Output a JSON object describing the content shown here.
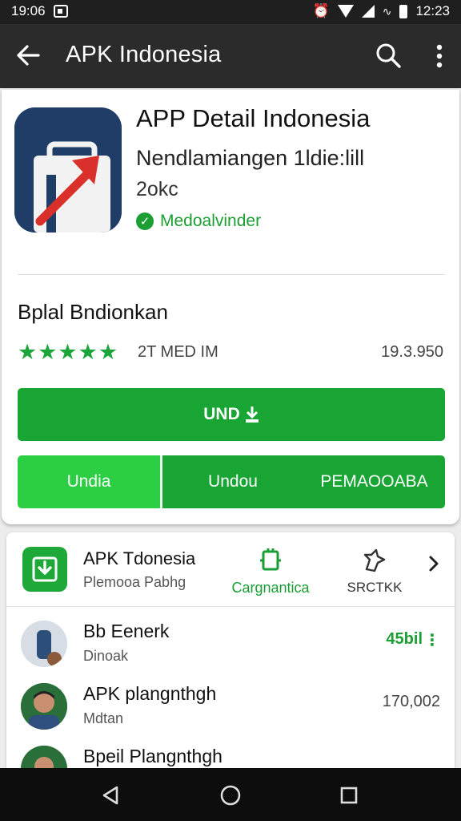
{
  "status_bar": {
    "time_left": "19:06",
    "time_right": "12:23"
  },
  "app_bar": {
    "title": "APK Indonesia"
  },
  "app": {
    "title": "APP  Detail Indonesia",
    "developer": "Nendlamiangen 1ldie:lill",
    "size": "2okc",
    "verified_label": "Medoalvinder"
  },
  "section": {
    "title": "Bplal Bndionkan",
    "stars": "★★★★★",
    "stat_mid": "2T MED IM",
    "stat_right": "19.3.950"
  },
  "buttons": {
    "main": "UND",
    "left": "Undia",
    "middle": "Undou",
    "right": "PEMAOOABA"
  },
  "mini_card": {
    "title": "APK Tdonesia",
    "subtitle": "Plemooa Pabhg",
    "action1_label": "Cargnantica",
    "action2_label": "SRCTKK"
  },
  "list": [
    {
      "name": "Bb Eenerk",
      "sub": "Dinoak",
      "value": "45bil",
      "value_color": "#1b9e32"
    },
    {
      "name": "APK plangnthgh",
      "sub": "Mdtan",
      "value": "170,002"
    },
    {
      "name": "Bpeil Plangnthgh"
    }
  ],
  "colors": {
    "accent": "#18a533",
    "accent_light": "#2cce44",
    "appbar": "#2b2b2b"
  },
  "icons": [
    "back-arrow-icon",
    "search-icon",
    "more-vert-icon",
    "check-circle-icon",
    "download-icon",
    "share-icon",
    "chevron-right-icon",
    "back-nav-icon",
    "home-nav-icon",
    "recents-nav-icon"
  ]
}
